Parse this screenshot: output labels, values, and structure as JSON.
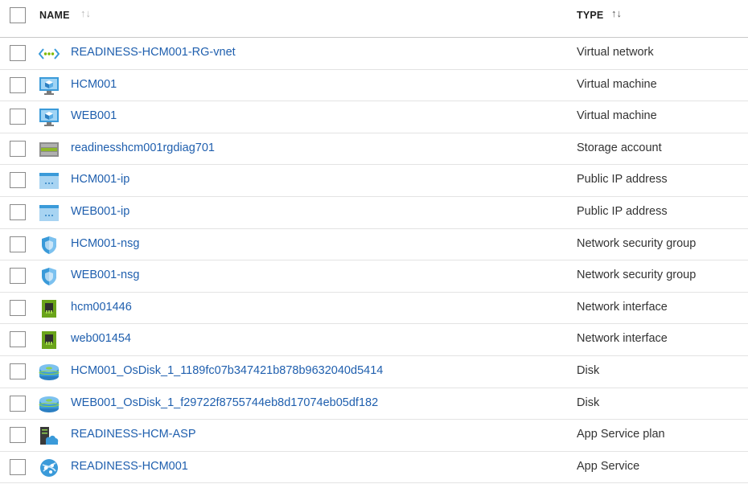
{
  "header": {
    "name_label": "NAME",
    "type_label": "TYPE",
    "sort_icon": "↑↓"
  },
  "rows": [
    {
      "name": "READINESS-HCM001-RG-vnet",
      "type": "Virtual network",
      "icon": "virtual-network-icon"
    },
    {
      "name": "HCM001",
      "type": "Virtual machine",
      "icon": "virtual-machine-icon"
    },
    {
      "name": "WEB001",
      "type": "Virtual machine",
      "icon": "virtual-machine-icon"
    },
    {
      "name": "readinesshcm001rgdiag701",
      "type": "Storage account",
      "icon": "storage-account-icon"
    },
    {
      "name": "HCM001-ip",
      "type": "Public IP address",
      "icon": "public-ip-icon"
    },
    {
      "name": "WEB001-ip",
      "type": "Public IP address",
      "icon": "public-ip-icon"
    },
    {
      "name": "HCM001-nsg",
      "type": "Network security group",
      "icon": "shield-icon"
    },
    {
      "name": "WEB001-nsg",
      "type": "Network security group",
      "icon": "shield-icon"
    },
    {
      "name": "hcm001446",
      "type": "Network interface",
      "icon": "network-interface-icon"
    },
    {
      "name": "web001454",
      "type": "Network interface",
      "icon": "network-interface-icon"
    },
    {
      "name": "HCM001_OsDisk_1_1189fc07b347421b878b9632040d5414",
      "type": "Disk",
      "icon": "disk-icon"
    },
    {
      "name": "WEB001_OsDisk_1_f29722f8755744eb8d17074eb05df182",
      "type": "Disk",
      "icon": "disk-icon"
    },
    {
      "name": "READINESS-HCM-ASP",
      "type": "App Service plan",
      "icon": "app-service-plan-icon"
    },
    {
      "name": "READINESS-HCM001",
      "type": "App Service",
      "icon": "app-service-icon"
    }
  ],
  "colors": {
    "link": "#1f5fae",
    "text": "#333333",
    "azure_blue": "#3a9ad9",
    "nic_green": "#7fba00"
  }
}
